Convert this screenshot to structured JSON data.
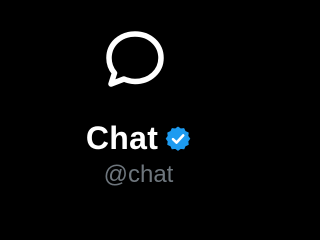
{
  "profile": {
    "display_name": "Chat",
    "handle": "@chat",
    "avatar_icon": "chat-bubble-icon",
    "verified_icon": "verified-badge-icon",
    "verified": true
  },
  "colors": {
    "background": "#000000",
    "name": "#ffffff",
    "handle": "#6e767d",
    "verified": "#1d9bf0"
  }
}
